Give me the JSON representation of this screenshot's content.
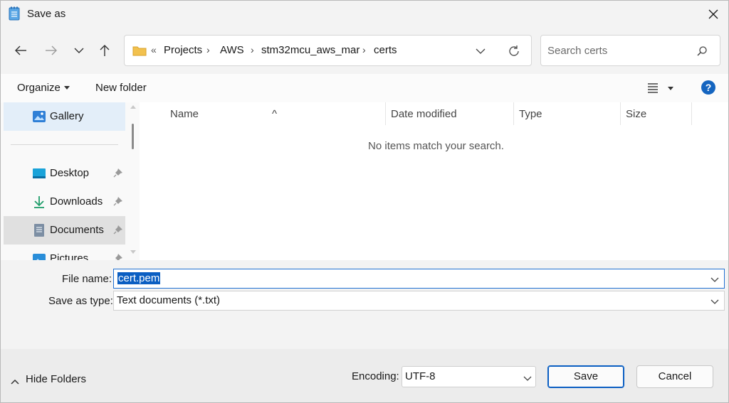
{
  "window": {
    "title": "Save as",
    "close_label": "×"
  },
  "navbar": {
    "breadcrumb_overflow": "«",
    "breadcrumbs": [
      "Projects",
      "AWS",
      "stm32mcu_aws_mar",
      "certs"
    ],
    "search_placeholder": "Search certs"
  },
  "cmdbar": {
    "organize_label": "Organize",
    "new_folder_label": "New folder",
    "help_label": "?"
  },
  "sidebar": {
    "items": [
      {
        "label": "Gallery",
        "icon": "gallery-icon"
      },
      {
        "label": "Desktop",
        "icon": "desktop-icon",
        "pinned": true
      },
      {
        "label": "Downloads",
        "icon": "download-icon",
        "pinned": true
      },
      {
        "label": "Documents",
        "icon": "documents-icon",
        "pinned": true
      },
      {
        "label": "Pictures",
        "icon": "pictures-icon",
        "pinned": true
      }
    ]
  },
  "filelist": {
    "columns": [
      "Name",
      "Date modified",
      "Type",
      "Size"
    ],
    "empty_message": "No items match your search."
  },
  "form": {
    "file_name_label": "File name:",
    "file_name_value": "cert.pem",
    "save_type_label": "Save as type:",
    "save_type_value": "Text documents (*.txt)"
  },
  "footer": {
    "hide_folders_label": "Hide Folders",
    "encoding_label": "Encoding:",
    "encoding_value": "UTF-8",
    "save_label": "Save",
    "cancel_label": "Cancel"
  },
  "colors": {
    "accent": "#0a5ec2",
    "help": "#1565c0",
    "folder": "#f2c14e"
  }
}
